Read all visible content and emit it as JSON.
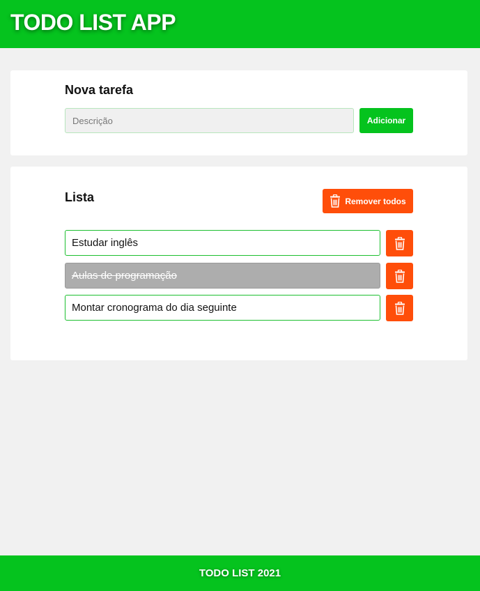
{
  "header": {
    "title": "TODO LIST APP"
  },
  "new_task": {
    "title": "Nova tarefa",
    "input_placeholder": "Descrição",
    "input_value": "",
    "add_label": "Adicionar"
  },
  "list": {
    "title": "Lista",
    "remove_all_label": "Remover todos",
    "remove_all_icon": "trash-icon",
    "delete_icon": "trash-icon",
    "tasks": [
      {
        "text": "Estudar inglês",
        "done": false
      },
      {
        "text": "Aulas de programação",
        "done": true
      },
      {
        "text": "Montar cronograma do dia seguinte",
        "done": false
      }
    ]
  },
  "footer": {
    "text": "TODO LIST 2021"
  },
  "colors": {
    "brand_green": "#05c31e",
    "danger_orange": "#ff4e0a",
    "done_gray": "#adadad",
    "background": "#f1f1f1"
  }
}
